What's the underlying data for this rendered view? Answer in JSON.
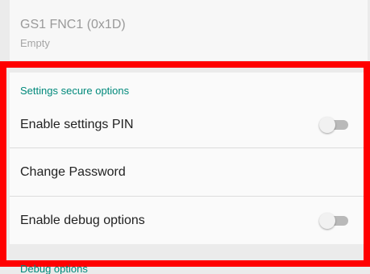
{
  "top_item": {
    "title": "GS1 FNC1 (0x1D)",
    "summary": "Empty"
  },
  "secure_section": {
    "header": "Settings secure options",
    "items": [
      {
        "label": "Enable settings PIN",
        "toggle": false
      },
      {
        "label": "Change Password"
      },
      {
        "label": "Enable debug options",
        "toggle": false
      }
    ]
  },
  "next_section": {
    "header": "Debug options"
  },
  "colors": {
    "accent": "#00897b",
    "highlight_border": "#ff0000"
  }
}
